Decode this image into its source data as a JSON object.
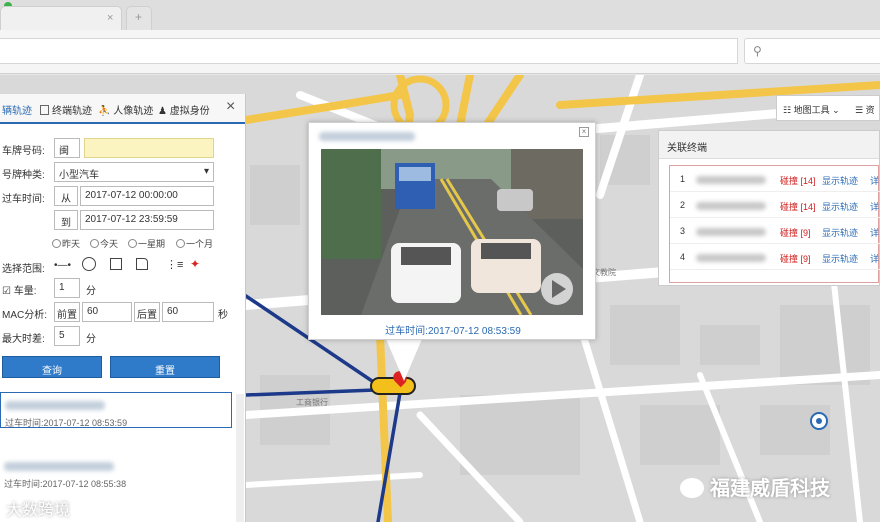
{
  "browser": {
    "new_tab_label": "+",
    "search_icon": "search-icon"
  },
  "left_panel": {
    "tabs": [
      {
        "label": "辆轨迹",
        "active": true
      },
      {
        "label": "终端轨迹",
        "active": false
      },
      {
        "label": "人像轨迹",
        "active": false
      },
      {
        "label": "虚拟身份",
        "active": false
      }
    ],
    "plate_label": "车牌号码:",
    "plate_prefix": "闽",
    "plate_type_label": "号牌种类:",
    "plate_type_value": "小型汽车",
    "time_label": "过车时间:",
    "from_label": "从",
    "from_value": "2017-07-12 00:00:00",
    "to_label": "到",
    "to_value": "2017-07-12 23:59:59",
    "quick_ranges": [
      "昨天",
      "今天",
      "一星期",
      "一个月"
    ],
    "select_range_label": "选择范围:",
    "car_count_label": "车量:",
    "car_count_value": "1",
    "car_count_unit": "分",
    "mac_label": "MAC分析:",
    "before_label": "前置",
    "before_value": "60",
    "after_label": "后置",
    "after_value": "60",
    "mac_unit": "秒",
    "max_interval_label": "最大时差:",
    "max_interval_value": "5",
    "max_interval_unit": "分",
    "query_button": "查询",
    "reset_button": "重置",
    "results": [
      {
        "time": "过车时间:2017-07-12 08:53:59"
      },
      {
        "time": "过车时间:2017-07-12 08:55:38"
      }
    ]
  },
  "popup": {
    "time_text": "过车时间:2017-07-12 08:53:59",
    "close": "×"
  },
  "map_tools": {
    "tool_label": "地图工具",
    "extra_label": "资"
  },
  "right_panel": {
    "title": "关联终端",
    "rows": [
      {
        "n": "1",
        "hits": "碰撞 [14]",
        "action": "显示轨迹",
        "more": "详"
      },
      {
        "n": "2",
        "hits": "碰撞 [14]",
        "action": "显示轨迹",
        "more": "详"
      },
      {
        "n": "3",
        "hits": "碰撞 [9]",
        "action": "显示轨迹",
        "more": "详"
      },
      {
        "n": "4",
        "hits": "碰撞 [9]",
        "action": "显示轨迹",
        "more": "详"
      }
    ]
  },
  "map_labels": {
    "label_a": "工商银行",
    "label_b": "文教院"
  },
  "watermarks": {
    "brand": "福建威盾科技",
    "bottom": "大数跨境"
  },
  "colors": {
    "accent": "#2a6ab5",
    "alert": "#d01c1c",
    "road": "#ffffff",
    "track": "#1d3a8a",
    "main_road": "#f3c64a"
  }
}
